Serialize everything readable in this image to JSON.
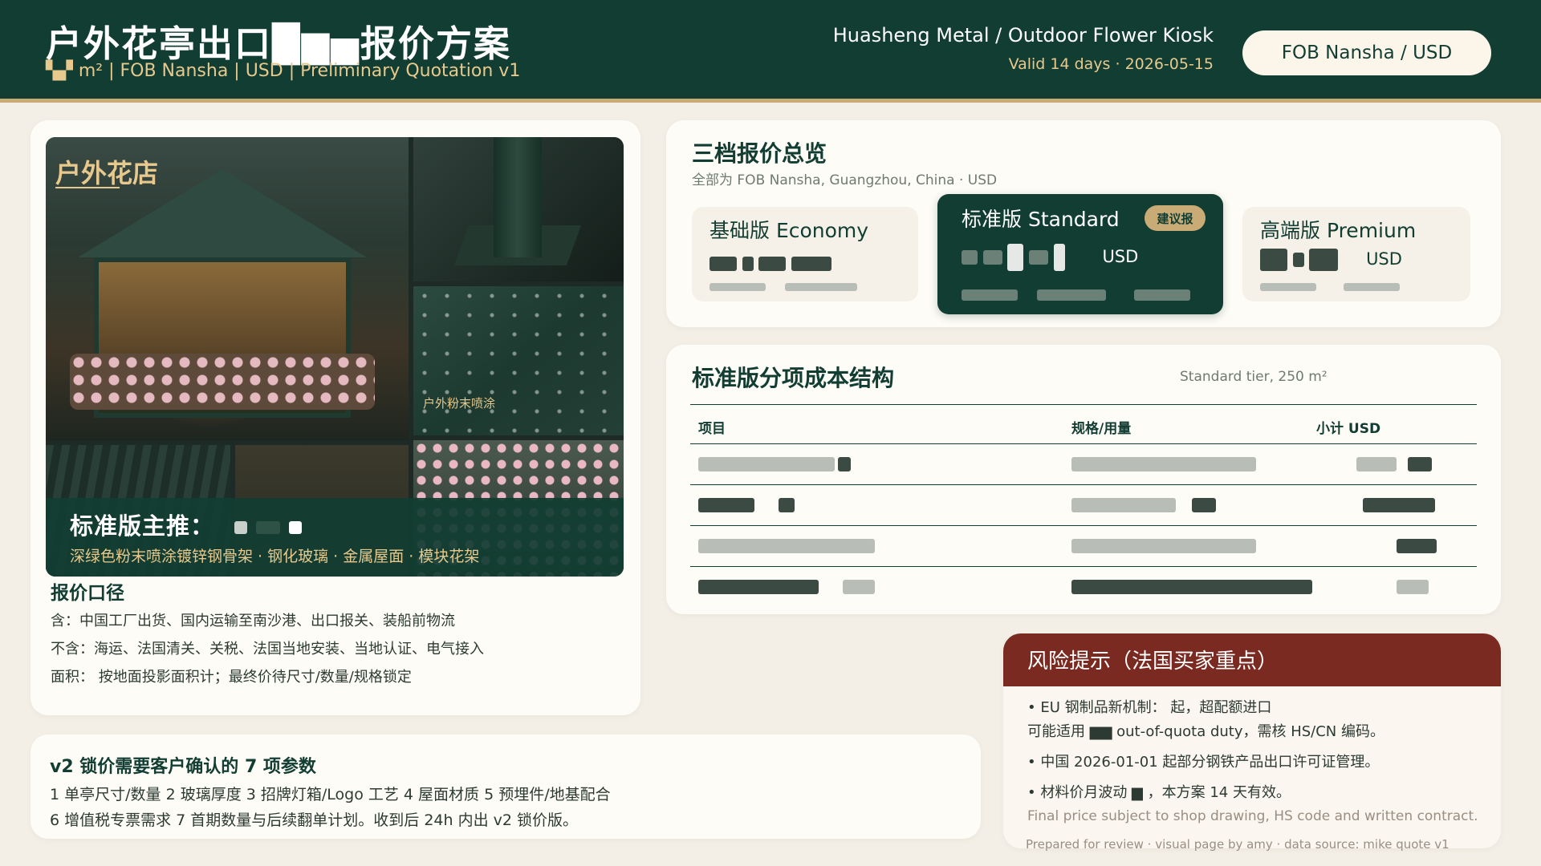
{
  "header": {
    "title": "户外花亭出口█▆▅报价方案",
    "subtitle": "▚▞ m² | FOB Nansha | USD | Preliminary Quotation v1",
    "company": "Huasheng Metal / Outdoor Flower Kiosk",
    "validity": "Valid 14 days · 2026-05-15",
    "badge": "FOB Nansha / USD"
  },
  "gallery": {
    "main_label": "户外花店",
    "powder_label": "户外粉末喷涂",
    "overlay_title": "标准版主推：",
    "overlay_sub": "深绿色粉末喷涂镀锌钢骨架 · 钢化玻璃 · 金属屋面 · 模块花架"
  },
  "scope": {
    "title": "报价口径",
    "included": "含：中国工厂出货、国内运输至南沙港、出口报关、装船前物流",
    "excluded": "不含：海运、法国清关、关税、法国当地安装、当地认证、电气接入",
    "area": "面积：        按地面投影面积计；最终价待尺寸/数量/规格锁定"
  },
  "overview": {
    "title": "三档报价总览",
    "subtitle": "全部为 FOB Nansha, Guangzhou, China · USD",
    "tiers": [
      {
        "name": "基础版 Economy",
        "currency": "USD",
        "recommended": false
      },
      {
        "name": "标准版 Standard",
        "currency": "USD",
        "recommended": true,
        "badge": "建议报"
      },
      {
        "name": "高端版 Premium",
        "currency": "USD",
        "recommended": false
      }
    ]
  },
  "cost": {
    "title": "标准版分项成本结构",
    "note": "Standard tier, 250 m²",
    "headers": [
      "项目",
      "规格/用量",
      "小计 USD"
    ]
  },
  "lock": {
    "title": "v2 锁价需要客户确认的 7 项参数",
    "line1": "1 单亭尺寸/数量    2 玻璃厚度    3 招牌灯箱/Logo 工艺    4 屋面材质    5 预埋件/地基配合",
    "line2": "6 增值税专票需求    7 首期数量与后续翻单计划。收到后 24h 内出 v2 锁价版。"
  },
  "risk": {
    "title": "风险提示（法国买家重点）",
    "line1": "• EU 钢制品新机制：              起，超配额进口",
    "line2": "   可能适用 ▆▆ out-of-quota duty，需核 HS/CN 编码。",
    "line3": "• 中国 2026-01-01 起部分钢铁产品出口许可证管理。",
    "line4": "• 材料价月波动  ▆  ，本方案 14 天有效。",
    "note": "Final price subject to shop drawing, HS code and written contract."
  },
  "footer": "Prepared for review · visual page by amy · data source: mike quote v1",
  "colors": {
    "primary": "#123d33",
    "gold": "#c9ab76",
    "risk": "#7a2a20",
    "background": "#f3efe6"
  }
}
